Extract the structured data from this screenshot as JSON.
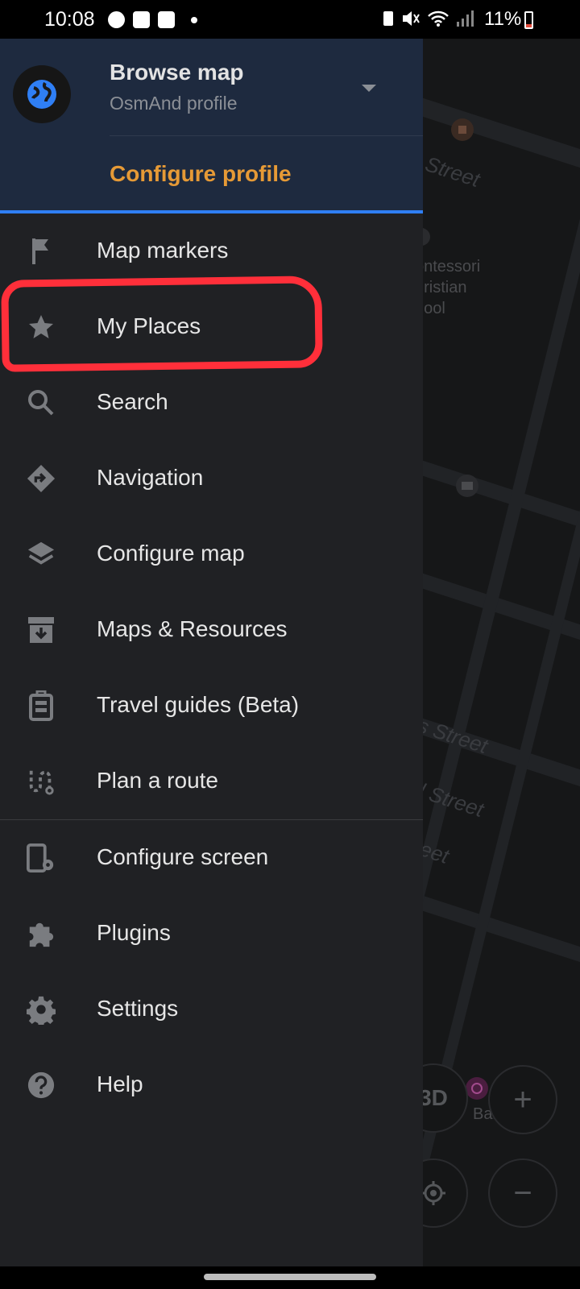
{
  "status_bar": {
    "time": "10:08",
    "battery": "11%",
    "left_icons": [
      "messenger-icon",
      "gallery-icon",
      "alert-icon"
    ],
    "right_icons": [
      "battery-saver-icon",
      "mute-icon",
      "wifi-icon",
      "signal-icon"
    ]
  },
  "profile": {
    "title": "Browse map",
    "subtitle": "OsmAnd profile",
    "configure": "Configure profile"
  },
  "menu": {
    "items": [
      {
        "label": "Map markers",
        "icon": "flag-icon"
      },
      {
        "label": "My Places",
        "icon": "star-icon"
      },
      {
        "label": "Search",
        "icon": "search-icon"
      },
      {
        "label": "Navigation",
        "icon": "navigation-icon"
      },
      {
        "label": "Configure map",
        "icon": "layers-icon"
      },
      {
        "label": "Maps & Resources",
        "icon": "download-box-icon"
      },
      {
        "label": "Travel guides (Beta)",
        "icon": "luggage-icon"
      },
      {
        "label": "Plan a route",
        "icon": "route-icon"
      }
    ],
    "items2": [
      {
        "label": "Configure screen",
        "icon": "screen-settings-icon"
      },
      {
        "label": "Plugins",
        "icon": "puzzle-icon"
      },
      {
        "label": "Settings",
        "icon": "gear-icon"
      },
      {
        "label": "Help",
        "icon": "help-icon"
      }
    ]
  },
  "map": {
    "labels": [
      "Street",
      "ontessori",
      "hristian",
      "hool",
      "s Street",
      "l Street",
      "eet",
      "Bakery"
    ],
    "btn_3d": "3D",
    "zoom_in": "+",
    "zoom_out": "−"
  },
  "colors": {
    "accent": "#e69a36",
    "header_bg": "#1e2a3f",
    "drawer_bg": "#202124",
    "divider_blue": "#2f7ff5",
    "annotation_red": "#ff2f3a"
  }
}
